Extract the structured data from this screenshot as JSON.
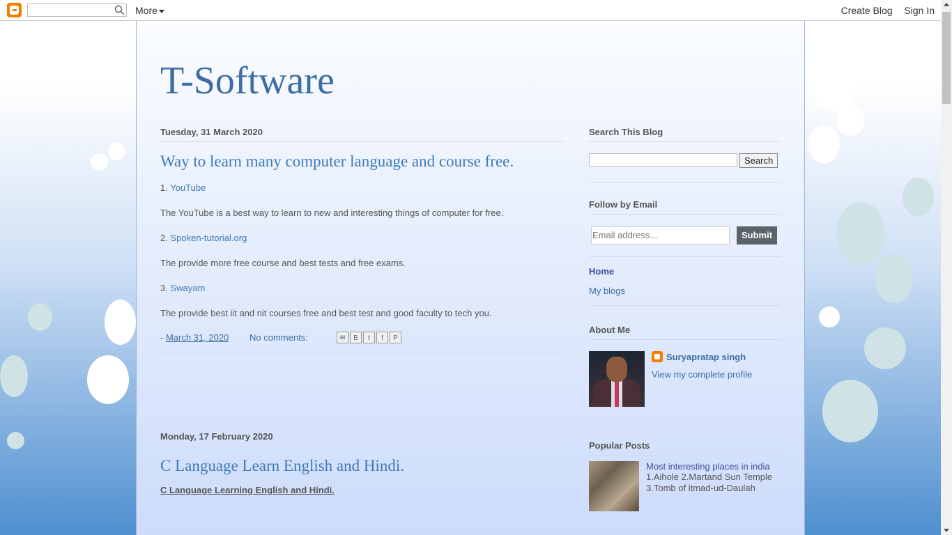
{
  "navbar": {
    "search_value": "",
    "more_label": "More",
    "create_blog": "Create Blog",
    "sign_in": "Sign In"
  },
  "blog": {
    "title": "T-Software"
  },
  "posts": [
    {
      "date": "Tuesday, 31 March 2020",
      "title": "Way to learn many computer language and course free.",
      "items": [
        {
          "num": "1. ",
          "link": "YouTube",
          "desc": "The YouTube is a best way to learn to new and interesting things of computer for free."
        },
        {
          "num": "2. ",
          "link": "Spoken-tutorial.org",
          "desc": "The provide more free course and best tests and free exams."
        },
        {
          "num": "3. ",
          "link": "Swayam",
          "desc": "The provide best iit and nit courses free and best test and good faculty to tech you."
        }
      ],
      "footer_prefix": "- ",
      "footer_date": "March 31, 2020",
      "comments": "No comments:",
      "share_icons": [
        "email-icon",
        "blogger-icon",
        "twitter-icon",
        "facebook-icon",
        "pinterest-icon"
      ]
    },
    {
      "date": "Monday, 17 February 2020",
      "title": "C Language Learn English and Hindi.",
      "subtitle": "C Language Learning English and Hindi."
    }
  ],
  "sidebar": {
    "search": {
      "title": "Search This Blog",
      "button": "Search"
    },
    "follow": {
      "title": "Follow by Email",
      "placeholder": "Email address...",
      "button": "Submit"
    },
    "pages": {
      "home": "Home",
      "my_blogs": "My blogs"
    },
    "about": {
      "title": "About Me",
      "name": "Suryapratap singh",
      "link": "View my complete profile"
    },
    "popular": {
      "title": "Popular Posts",
      "post_title": "Most interesting places in india",
      "snippet": "1.Aihole 2.Martand Sun Temple 3.Tomb of itmad-ud-Daulah"
    }
  },
  "colors": {
    "title_blue": "#3d6ea3",
    "link_blue": "#3d7ab5",
    "blogger_orange": "#f57d00"
  }
}
